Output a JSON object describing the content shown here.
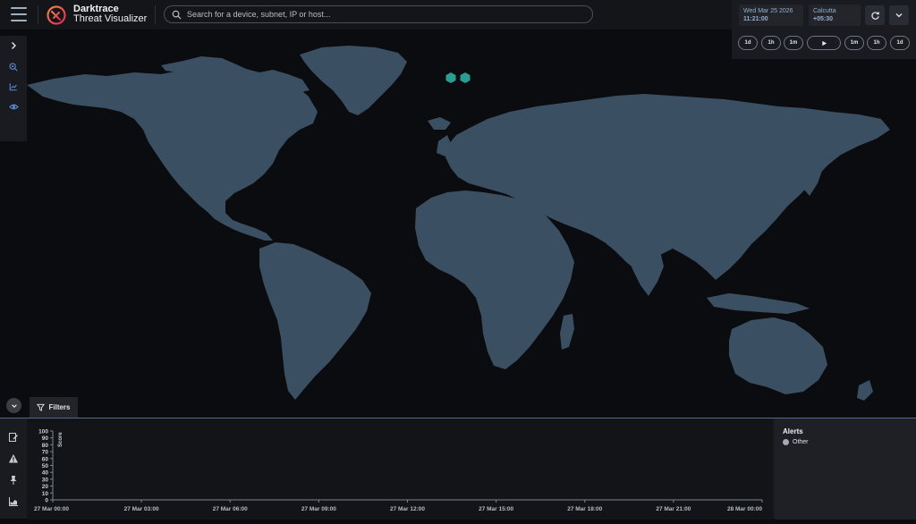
{
  "header": {
    "brand_line1": "Darktrace",
    "brand_line2": "Threat Visualizer",
    "search_placeholder": "Search for a device, subnet, IP or host..."
  },
  "time_panel": {
    "date": "Wed Mar 25 2026",
    "time": "11:21:00",
    "timezone": "Calcutta",
    "offset": "+05:30",
    "step_buttons_back": [
      "1d",
      "1h",
      "1m"
    ],
    "step_buttons_fwd": [
      "1m",
      "1h",
      "1d"
    ]
  },
  "filters": {
    "label": "Filters"
  },
  "chart_data": {
    "type": "line",
    "ylabel": "Score",
    "yticks": [
      "100",
      "90",
      "80",
      "70",
      "60",
      "50",
      "40",
      "30",
      "20",
      "10",
      "0"
    ],
    "ylim": [
      0,
      100
    ],
    "xticks": [
      "27 Mar 00:00",
      "27 Mar 03:00",
      "27 Mar 06:00",
      "27 Mar 09:00",
      "27 Mar 12:00",
      "27 Mar 15:00",
      "27 Mar 18:00",
      "27 Mar 21:00",
      "28 Mar 00:00"
    ],
    "series": []
  },
  "alerts": {
    "title": "Alerts",
    "legend": [
      {
        "label": "Other",
        "color": "#a7aab0"
      }
    ]
  },
  "colors": {
    "land": "#3b4f62",
    "marker": "#2a9d92",
    "accent": "#4d6a96"
  }
}
